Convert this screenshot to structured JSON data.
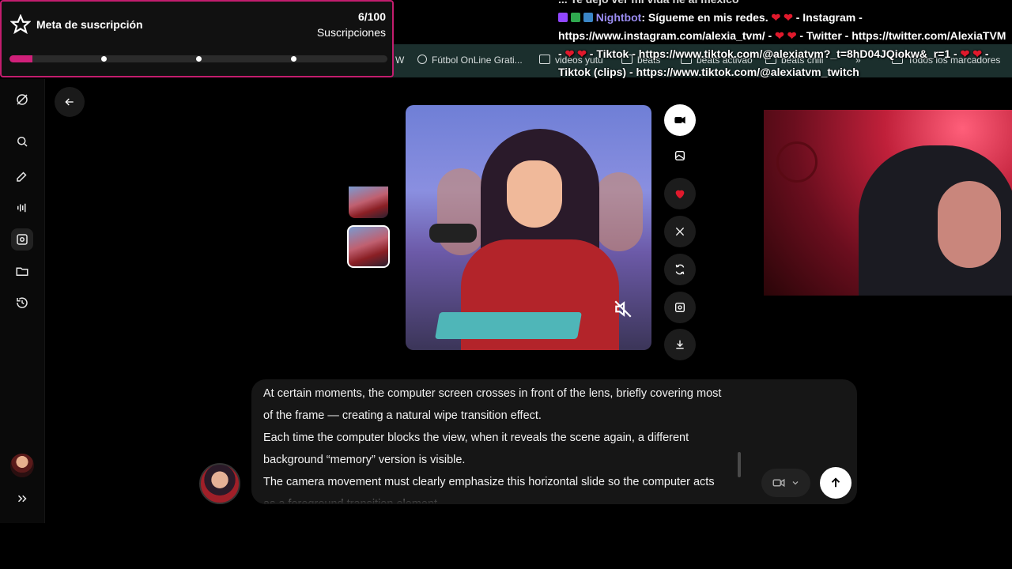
{
  "subscription_goal": {
    "title": "Meta de suscripción",
    "count": "6/100",
    "label": "Suscripciones",
    "progress": 0.06
  },
  "bookmarks_bar": {
    "items": [
      {
        "label": "Fútbol OnLine Grati...",
        "icon": "globe-icon"
      },
      {
        "label": "videos yutu",
        "icon": "folder-icon"
      },
      {
        "label": "beats",
        "icon": "folder-icon"
      },
      {
        "label": "beats activao",
        "icon": "folder-icon"
      },
      {
        "label": "beats chill",
        "icon": "folder-icon"
      },
      {
        "label": "Todos los marcadores",
        "icon": "folder-icon"
      }
    ]
  },
  "chat": {
    "top_line": "... Te dejo ver mi vida ne al mexico",
    "user": "Nightbot",
    "message_1": ": Sígueme en mis redes.",
    "message_2": " - Instagram - https://www.instagram.com/alexia_tvm/ -",
    "message_3": " - Twitter - https://twitter.com/AlexiaTVM -",
    "message_4": " - Tiktok - https://www.tiktok.com/@alexiatvm?_t=8hD04JQiokw&_r=1 -",
    "message_5": " - Tiktok (clips) - https://www.tiktok.com/@alexiatvm_twitch"
  },
  "prompt": {
    "lines": [
      "At certain moments, the computer screen crosses in front of the lens, briefly covering most of the frame — creating a natural wipe transition effect.",
      "Each time the computer blocks the view, when it reveals the scene again, a different background “memory” version is visible.",
      "The camera movement must clearly emphasize this horizontal slide so the computer acts as a foreground transition element."
    ]
  },
  "colors": {
    "accent_pink": "#c31d6e",
    "nightbot": "#9b8df2",
    "heart": "#e0192c",
    "bookmarks_bg": "#1b2f2d"
  }
}
